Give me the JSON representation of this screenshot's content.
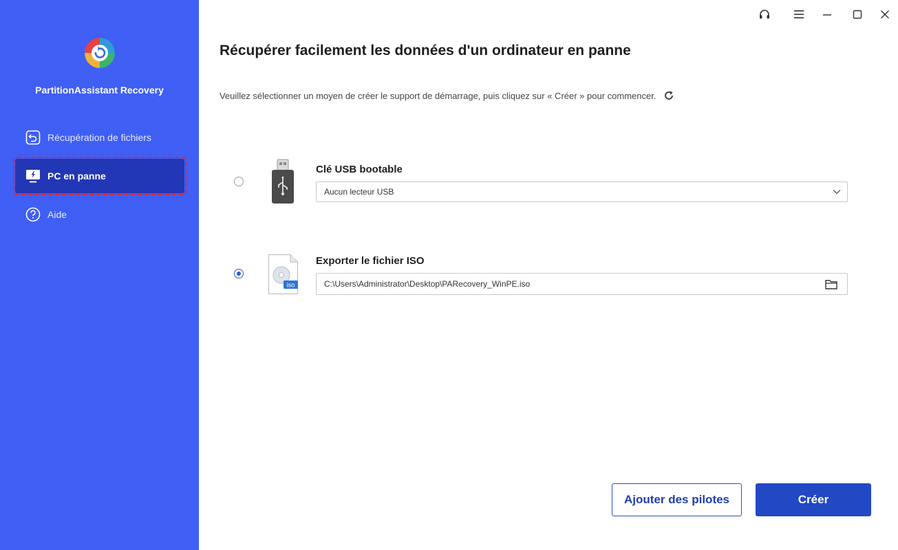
{
  "sidebar": {
    "app_name": "PartitionAssistant Recovery",
    "items": [
      {
        "label": "Récupération de fichiers",
        "icon": "file-recovery-icon",
        "active": false
      },
      {
        "label": "PC en panne",
        "icon": "crashed-pc-icon",
        "active": true
      },
      {
        "label": "Aide",
        "icon": "help-icon",
        "active": false
      }
    ]
  },
  "titlebar": {
    "icons": [
      "headset-icon",
      "menu-icon",
      "minimize-icon",
      "maximize-icon",
      "close-icon"
    ]
  },
  "main": {
    "title": "Récupérer facilement les données d'un ordinateur en panne",
    "subtitle": "Veuillez sélectionner un moyen de créer le support de démarrage, puis cliquez sur « Créer » pour commencer.",
    "options": [
      {
        "title": "Clé USB bootable",
        "value": "Aucun lecteur USB",
        "selected": false
      },
      {
        "title": "Exporter le fichier ISO",
        "value": "C:\\Users\\Administrator\\Desktop\\PARecovery_WinPE.iso",
        "selected": true,
        "badge": "iso"
      }
    ],
    "buttons": {
      "add_drivers": "Ajouter des pilotes",
      "create": "Créer"
    }
  },
  "colors": {
    "sidebar_bg": "#3f5ff5",
    "active_item_bg": "#2237b5",
    "primary_button": "#2248c4",
    "highlight_outline": "#e0242e"
  }
}
